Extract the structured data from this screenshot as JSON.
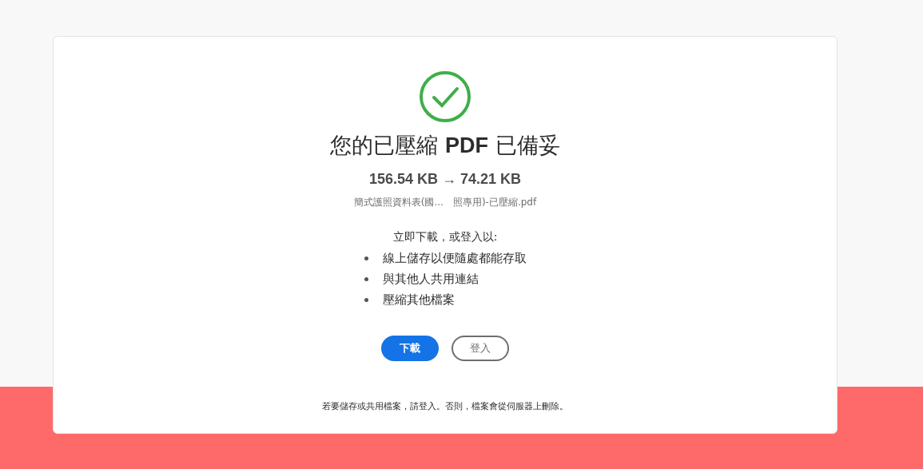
{
  "title_prefix": "您的已壓縮",
  "title_bold": "PDF",
  "title_suffix": "已備妥",
  "size": "156.54 KB → 74.21 KB",
  "filename": "簡式護照資料表(國...　照專用)-已壓縮.pdf",
  "intro": "立即下載，或登入以:",
  "benefits": [
    "線上儲存以便隨處都能存取",
    "與其他人共用連結",
    "壓縮其他檔案"
  ],
  "buttons": [
    {
      "label": "下載",
      "kind": "primary"
    },
    {
      "label": "登入",
      "kind": "secondary"
    }
  ],
  "footer": "若要儲存或共用檔案，請登入。否則，檔案會從伺服器上刪除。"
}
